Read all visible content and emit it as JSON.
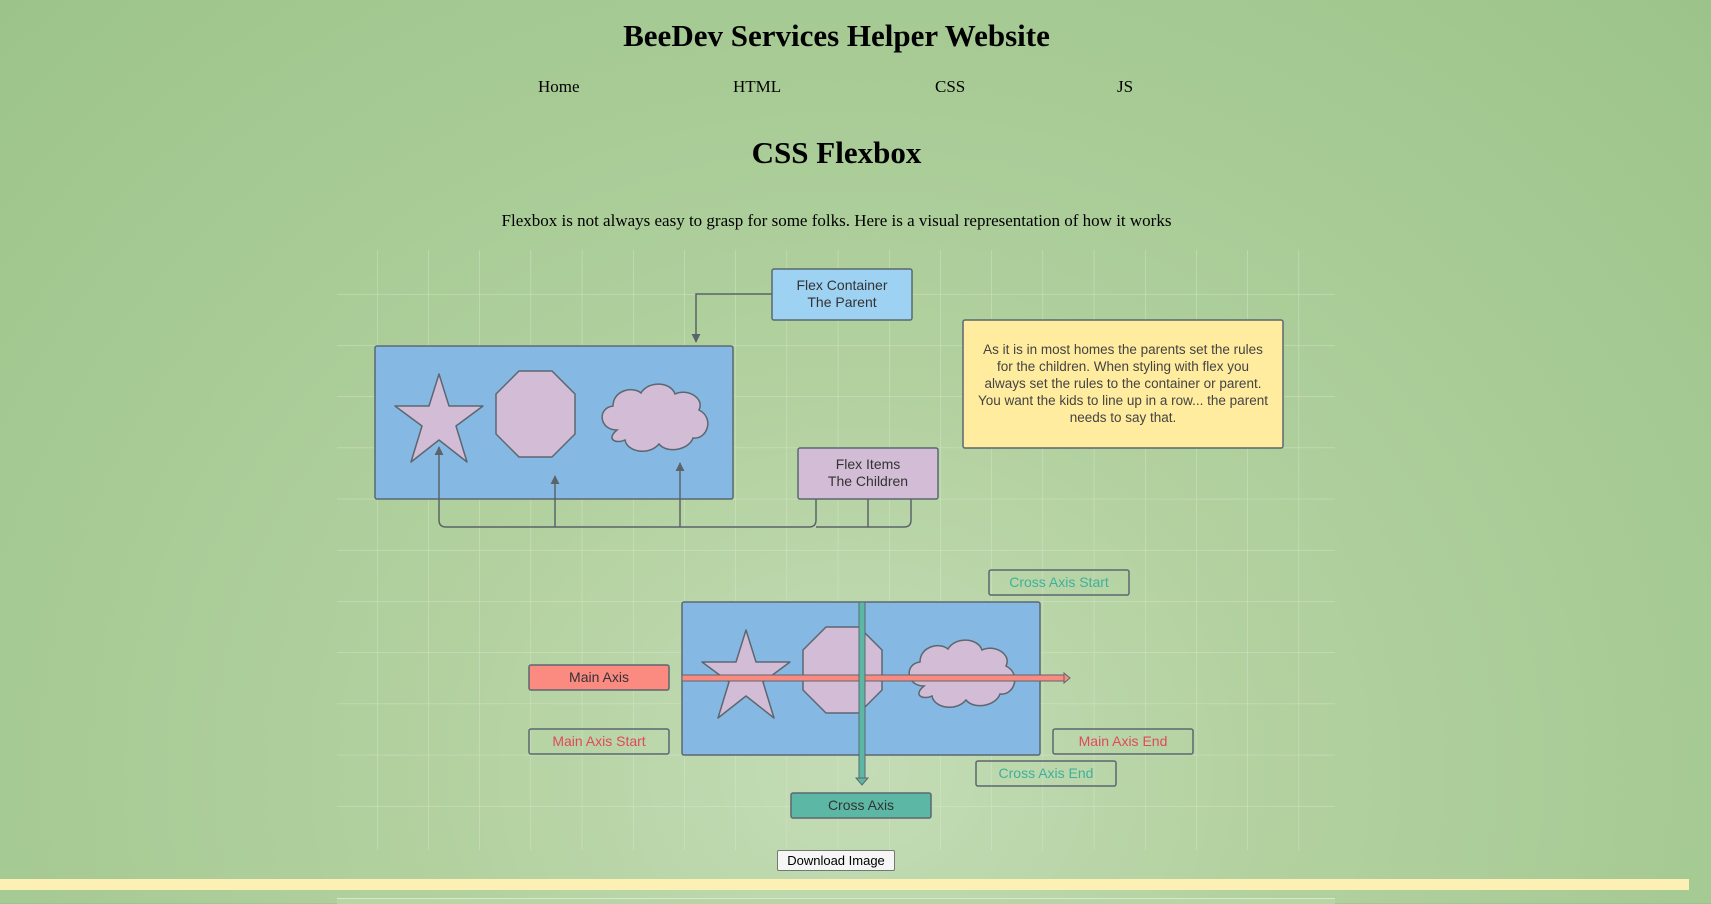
{
  "header": {
    "title": "BeeDev Services Helper Website"
  },
  "nav": {
    "items": [
      "Home",
      "HTML",
      "CSS",
      "JS"
    ]
  },
  "main": {
    "heading": "CSS Flexbox",
    "intro": "Flexbox is not always easy to grasp for some folks. Here is a visual representation of how it works",
    "download_label": "Download Image"
  },
  "diagram": {
    "flex_container_line1": "Flex Container",
    "flex_container_line2": "The Parent",
    "flex_items_line1": "Flex Items",
    "flex_items_line2": "The Children",
    "note_lines": [
      "As it is in most homes the parents set the rules",
      "for the children.  When styling with flex you",
      "always set the rules to the container or parent.",
      "You want the kids to line up in a row... the parent",
      "needs to say that."
    ],
    "cross_axis_start": "Cross Axis Start",
    "main_axis": "Main Axis",
    "main_axis_start": "Main Axis Start",
    "main_axis_end": "Main Axis End",
    "cross_axis_end": "Cross Axis End",
    "cross_axis": "Cross Axis"
  },
  "colors": {
    "container_blue": "#85b9e4",
    "item_lilac": "#d3bcd6",
    "note_yellow": "#ffec9e",
    "main_axis_red": "#fb8a80",
    "main_axis_text": "#e0495a",
    "cross_axis_teal": "#5cb8a4",
    "cross_axis_text": "#3fb09a",
    "bottom_bar": "#fdf0b4"
  }
}
